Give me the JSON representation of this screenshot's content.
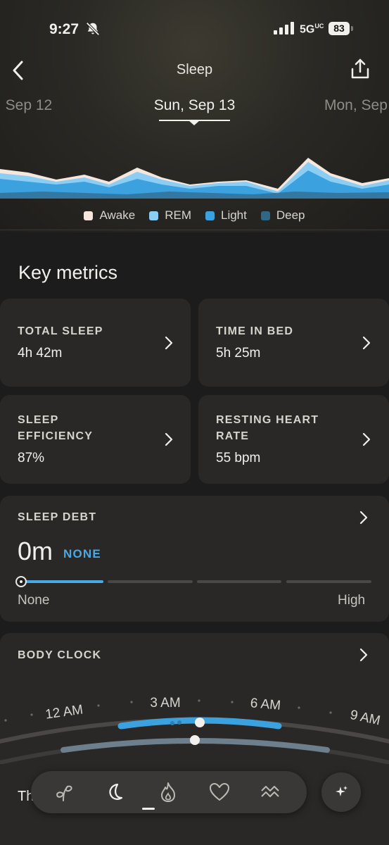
{
  "status_bar": {
    "time": "9:27",
    "network": "5G",
    "network_sup": "UC",
    "battery": "83"
  },
  "header": {
    "title": "Sleep",
    "back_icon": "chevron-left-icon",
    "share_icon": "share-icon"
  },
  "date_nav": {
    "prev": ", Sep 12",
    "current": "Sun, Sep 13",
    "next": "Mon, Sep"
  },
  "sleep_chart": {
    "legend": [
      {
        "name": "Awake",
        "color": "#f5e6de"
      },
      {
        "name": "REM",
        "color": "#8ccdf3"
      },
      {
        "name": "Light",
        "color": "#3ba1df"
      },
      {
        "name": "Deep",
        "color": "#2f6787"
      }
    ]
  },
  "key_metrics": {
    "title": "Key metrics",
    "cards": [
      {
        "label": "TOTAL SLEEP",
        "value": "4h 42m"
      },
      {
        "label": "TIME IN BED",
        "value": "5h 25m"
      },
      {
        "label": "SLEEP\nEFFICIENCY",
        "value": "87%"
      },
      {
        "label": "RESTING HEART\nRATE",
        "value": "55 bpm"
      }
    ]
  },
  "sleep_debt": {
    "label": "SLEEP DEBT",
    "value": "0m",
    "level": "NONE",
    "scale_min": "None",
    "scale_max": "High",
    "level_fraction": 0.0
  },
  "body_clock": {
    "label": "BODY CLOCK",
    "hours": [
      "12 AM",
      "3 AM",
      "6 AM",
      "9 AM"
    ],
    "text": "This aligns with your chronotype."
  },
  "colors": {
    "accent": "#4aa8e5",
    "card": "#2a2827"
  },
  "tabbar": {
    "tabs": [
      "sprout-icon",
      "moon-icon",
      "flame-icon",
      "heart-icon",
      "waves-icon"
    ],
    "active": "moon-icon",
    "ai_button": "sparkle-icon"
  }
}
